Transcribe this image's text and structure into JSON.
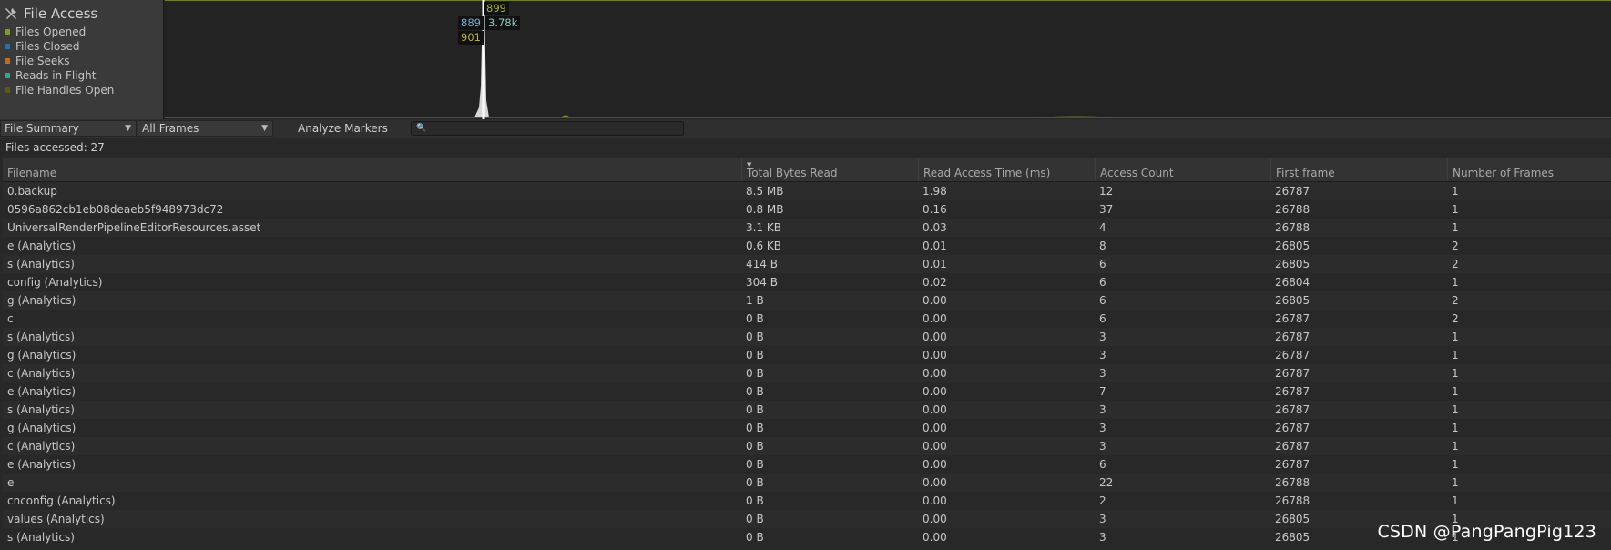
{
  "chart": {
    "title": "File Access",
    "legend": [
      {
        "label": "Files Opened",
        "color": "#7f9a1e"
      },
      {
        "label": "Files Closed",
        "color": "#2e6fa8"
      },
      {
        "label": "File Seeks",
        "color": "#c26a1a"
      },
      {
        "label": "Reads in Flight",
        "color": "#2aa7a3"
      },
      {
        "label": "File Handles Open",
        "color": "#5b5b13"
      }
    ],
    "tooltips": [
      {
        "text": "899",
        "color": "#a9b02a"
      },
      {
        "text": "889",
        "color": "#6fb0d8"
      },
      {
        "text": "3.78k",
        "color": "#8fc8c6"
      },
      {
        "text": "901",
        "color": "#b8b045"
      }
    ]
  },
  "toolbar": {
    "view_select": "File Summary",
    "frames_select": "All Frames",
    "analyze_label": "Analyze Markers",
    "search_value": ""
  },
  "summary": {
    "files_accessed": "Files accessed: 27"
  },
  "table": {
    "sort_indicator": "▼",
    "columns": [
      "Filename",
      "Total Bytes Read",
      "Read Access Time (ms)",
      "Access Count",
      "First frame",
      "Number of Frames"
    ],
    "rows": [
      [
        "0.backup",
        "8.5 MB",
        "1.98",
        "12",
        "26787",
        "1"
      ],
      [
        "0596a862cb1eb08deaeb5f948973dc72",
        "0.8 MB",
        "0.16",
        "37",
        "26788",
        "1"
      ],
      [
        "UniversalRenderPipelineEditorResources.asset",
        "3.1 KB",
        "0.03",
        "4",
        "26788",
        "1"
      ],
      [
        "e (Analytics)",
        "0.6 KB",
        "0.01",
        "8",
        "26805",
        "2"
      ],
      [
        "s (Analytics)",
        "414 B",
        "0.01",
        "6",
        "26805",
        "2"
      ],
      [
        "config (Analytics)",
        "304 B",
        "0.02",
        "6",
        "26804",
        "1"
      ],
      [
        "g (Analytics)",
        "1 B",
        "0.00",
        "6",
        "26805",
        "2"
      ],
      [
        "c",
        "0 B",
        "0.00",
        "6",
        "26787",
        "2"
      ],
      [
        "s (Analytics)",
        "0 B",
        "0.00",
        "3",
        "26787",
        "1"
      ],
      [
        "g (Analytics)",
        "0 B",
        "0.00",
        "3",
        "26787",
        "1"
      ],
      [
        "c (Analytics)",
        "0 B",
        "0.00",
        "3",
        "26787",
        "1"
      ],
      [
        "e (Analytics)",
        "0 B",
        "0.00",
        "7",
        "26787",
        "1"
      ],
      [
        "s (Analytics)",
        "0 B",
        "0.00",
        "3",
        "26787",
        "1"
      ],
      [
        "g (Analytics)",
        "0 B",
        "0.00",
        "3",
        "26787",
        "1"
      ],
      [
        "c (Analytics)",
        "0 B",
        "0.00",
        "3",
        "26787",
        "1"
      ],
      [
        "e (Analytics)",
        "0 B",
        "0.00",
        "6",
        "26787",
        "1"
      ],
      [
        "e",
        "0 B",
        "0.00",
        "22",
        "26788",
        "1"
      ],
      [
        "cnconfig (Analytics)",
        "0 B",
        "0.00",
        "2",
        "26788",
        "1"
      ],
      [
        "values (Analytics)",
        "0 B",
        "0.00",
        "3",
        "26805",
        "1"
      ],
      [
        "s (Analytics)",
        "0 B",
        "0.00",
        "3",
        "26805",
        "1"
      ]
    ]
  },
  "watermark": "CSDN @PangPangPig123"
}
